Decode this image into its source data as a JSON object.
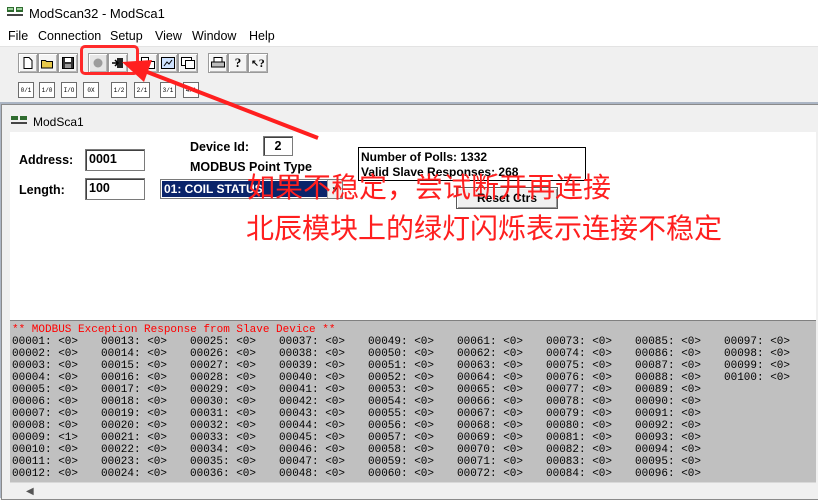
{
  "app": {
    "title": "ModScan32 - ModSca1"
  },
  "menu": [
    "File",
    "Connection",
    "Setup",
    "View",
    "Window",
    "Help"
  ],
  "toolbar1": [
    {
      "name": "new-icon",
      "glyph": "🗋"
    },
    {
      "name": "open-icon",
      "glyph": "📂"
    },
    {
      "name": "save-icon",
      "glyph": "💾"
    },
    {
      "name": "connect-icon",
      "glyph": "●"
    },
    {
      "name": "disconnect-icon",
      "glyph": "⇥"
    },
    {
      "name": "tile-icon",
      "glyph": "⧉"
    },
    {
      "name": "cascade-icon",
      "glyph": "▣"
    },
    {
      "name": "display-icon",
      "glyph": "▤"
    },
    {
      "name": "print-icon",
      "glyph": "⎙"
    },
    {
      "name": "help-icon",
      "glyph": "?"
    },
    {
      "name": "context-help-icon",
      "glyph": "?"
    }
  ],
  "toolbar2": [
    "0/1",
    "1/0",
    "I/O",
    "0X",
    "1/2",
    "2/1",
    "3/1",
    "4/1"
  ],
  "child": {
    "title": "ModSca1",
    "address_label": "Address:",
    "address_value": "0001",
    "length_label": "Length:",
    "length_value": "100",
    "device_id_label": "Device Id:",
    "device_id_value": "2",
    "point_type_label": "MODBUS Point Type",
    "point_type_value": "01: COIL STATUS",
    "polls": "Number of Polls: 1332",
    "valid": "Valid Slave Responses: 268",
    "reset_label": "Reset Ctrs",
    "exception": "** MODBUS Exception Response from Slave Device **"
  },
  "coils": {
    "values": [
      0,
      0,
      0,
      0,
      0,
      0,
      0,
      0,
      1,
      0,
      0,
      0,
      0,
      0,
      0,
      0,
      0,
      0,
      0,
      0,
      0,
      0,
      0,
      0,
      0,
      0,
      0,
      0,
      0,
      0,
      0,
      0,
      0,
      0,
      0,
      0,
      0,
      0,
      0,
      0,
      0,
      0,
      0,
      0,
      0,
      0,
      0,
      0,
      0,
      0,
      0,
      0,
      0,
      0,
      0,
      0,
      0,
      0,
      0,
      0,
      0,
      0,
      0,
      0,
      0,
      0,
      0,
      0,
      0,
      0,
      0,
      0,
      0,
      0,
      0,
      0,
      0,
      0,
      0,
      0,
      0,
      0,
      0,
      0,
      0,
      0,
      0,
      0,
      0,
      0,
      0,
      0,
      0,
      0,
      0,
      0,
      0,
      0,
      0,
      0
    ],
    "rows_per_column": 12
  },
  "annotation": {
    "line1": "如果不稳定，尝试断开再连接",
    "line2": "北辰模块上的绿灯闪烁表示连接不稳定",
    "color": "#ff1f1f"
  }
}
